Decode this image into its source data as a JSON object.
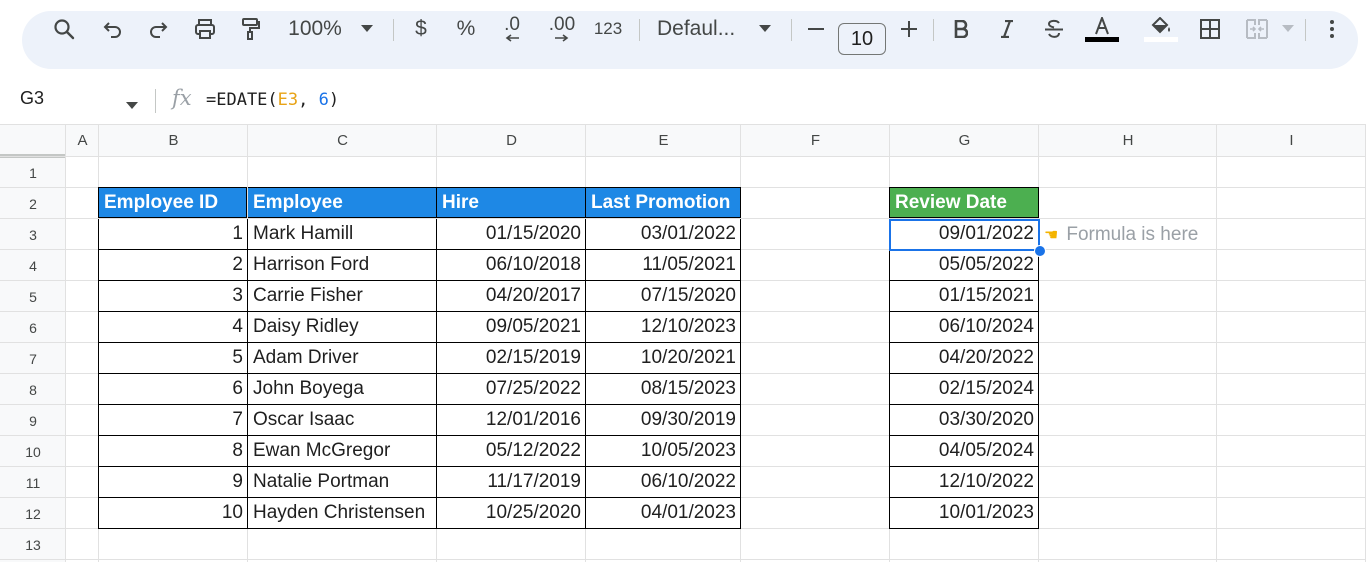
{
  "toolbar": {
    "zoom": "100%",
    "currency": "$",
    "percent": "%",
    "decrease_decimal": ".0",
    "increase_decimal": ".00",
    "number_format": "123",
    "font": "Defaul...",
    "font_size": "10"
  },
  "formula_bar": {
    "name_box": "G3",
    "formula_prefix": "=EDATE(",
    "formula_ref": "E3",
    "formula_sep": ", ",
    "formula_num": "6",
    "formula_suffix": ")"
  },
  "columns": [
    "A",
    "B",
    "C",
    "D",
    "E",
    "F",
    "G",
    "H",
    "I"
  ],
  "rows": [
    "1",
    "2",
    "3",
    "4",
    "5",
    "6",
    "7",
    "8",
    "9",
    "10",
    "11",
    "12",
    "13"
  ],
  "table": {
    "headers": [
      "Employee ID",
      "Employee",
      "Hire",
      "Last Promotion"
    ],
    "header_color": "#1e88e5",
    "rows": [
      [
        "1",
        "Mark Hamill",
        "01/15/2020",
        "03/01/2022"
      ],
      [
        "2",
        "Harrison Ford",
        "06/10/2018",
        "11/05/2021"
      ],
      [
        "3",
        "Carrie Fisher",
        "04/20/2017",
        "07/15/2020"
      ],
      [
        "4",
        "Daisy Ridley",
        "09/05/2021",
        "12/10/2023"
      ],
      [
        "5",
        "Adam Driver",
        "02/15/2019",
        "10/20/2021"
      ],
      [
        "6",
        "John Boyega",
        "07/25/2022",
        "08/15/2023"
      ],
      [
        "7",
        "Oscar Isaac",
        "12/01/2016",
        "09/30/2019"
      ],
      [
        "8",
        "Ewan McGregor",
        "05/12/2022",
        "10/05/2023"
      ],
      [
        "9",
        "Natalie Portman",
        "11/17/2019",
        "06/10/2022"
      ],
      [
        "10",
        "Hayden Christensen",
        "10/25/2020",
        "04/01/2023"
      ]
    ]
  },
  "review": {
    "header": "Review Date",
    "header_color": "#4caf50",
    "values": [
      "09/01/2022",
      "05/05/2022",
      "01/15/2021",
      "06/10/2024",
      "04/20/2022",
      "02/15/2024",
      "03/30/2020",
      "04/05/2024",
      "12/10/2022",
      "10/01/2023"
    ]
  },
  "note": {
    "icon": "pointing-hand-icon",
    "text": "Formula is here"
  }
}
